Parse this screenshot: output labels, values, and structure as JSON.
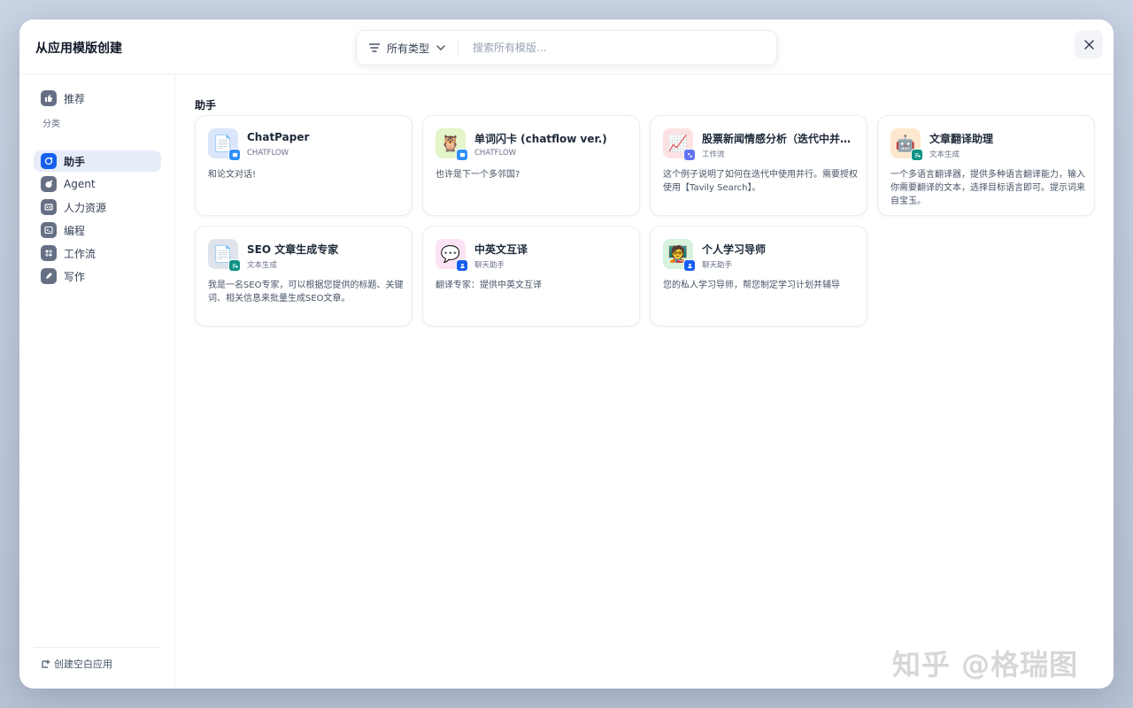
{
  "dialog": {
    "title": "从应用模版创建"
  },
  "search": {
    "type_filter_label": "所有类型",
    "placeholder": "搜索所有模版..."
  },
  "sidebar": {
    "recommend_label": "推荐",
    "section_label": "分类",
    "categories": [
      {
        "label": "助手",
        "icon": "assistant-icon",
        "active": true
      },
      {
        "label": "Agent",
        "icon": "agent-icon",
        "active": false
      },
      {
        "label": "人力资源",
        "icon": "hr-icon",
        "active": false
      },
      {
        "label": "编程",
        "icon": "terminal-icon",
        "active": false
      },
      {
        "label": "工作流",
        "icon": "workflow-icon",
        "active": false
      },
      {
        "label": "写作",
        "icon": "pen-icon",
        "active": false
      }
    ],
    "footer_label": "创建空白应用"
  },
  "main": {
    "section_heading": "助手",
    "cards": [
      {
        "name": "ChatPaper",
        "type": "CHATFLOW",
        "desc": "和论文对话!",
        "icon_bg": "#dbe6fb",
        "icon_glyph": "📄",
        "badge_color": "#2e90fa"
      },
      {
        "name": "单词闪卡 (chatflow ver.)",
        "type": "CHATFLOW",
        "desc": "也许是下一个多邻国?",
        "icon_bg": "#e3f5c9",
        "icon_glyph": "🦉",
        "badge_color": "#2e90fa"
      },
      {
        "name": "股票新闻情感分析（迭代中并行演示）",
        "type": "工作流",
        "desc": "这个例子说明了如何在迭代中使用并行。需要授权使用【Tavily Search】。",
        "icon_bg": "#fde2e4",
        "icon_glyph": "📈",
        "badge_color": "#6172f3"
      },
      {
        "name": "文章翻译助理",
        "type": "文本生成",
        "desc": "一个多语言翻译器，提供多种语言翻译能力，输入你需要翻译的文本，选择目标语言即可。提示词来自宝玉。",
        "icon_bg": "#fde8cf",
        "icon_glyph": "🤖",
        "badge_color": "#0e9384"
      },
      {
        "name": "SEO 文章生成专家",
        "type": "文本生成",
        "desc": "我是一名SEO专家，可以根据您提供的标题、关键词、相关信息来批量生成SEO文章。",
        "icon_bg": "#dfe3ec",
        "icon_glyph": "📄",
        "badge_color": "#0e9384"
      },
      {
        "name": "中英文互译",
        "type": "聊天助手",
        "desc": "翻译专家：提供中英文互译",
        "icon_bg": "#fbe3f3",
        "icon_glyph": "💬",
        "badge_color": "#155eef"
      },
      {
        "name": "个人学习导师",
        "type": "聊天助手",
        "desc": "您的私人学习导师，帮您制定学习计划并辅导",
        "icon_bg": "#d7f3dd",
        "icon_glyph": "🧑‍🏫",
        "badge_color": "#155eef"
      }
    ]
  },
  "watermark": "知乎 @格瑞图"
}
